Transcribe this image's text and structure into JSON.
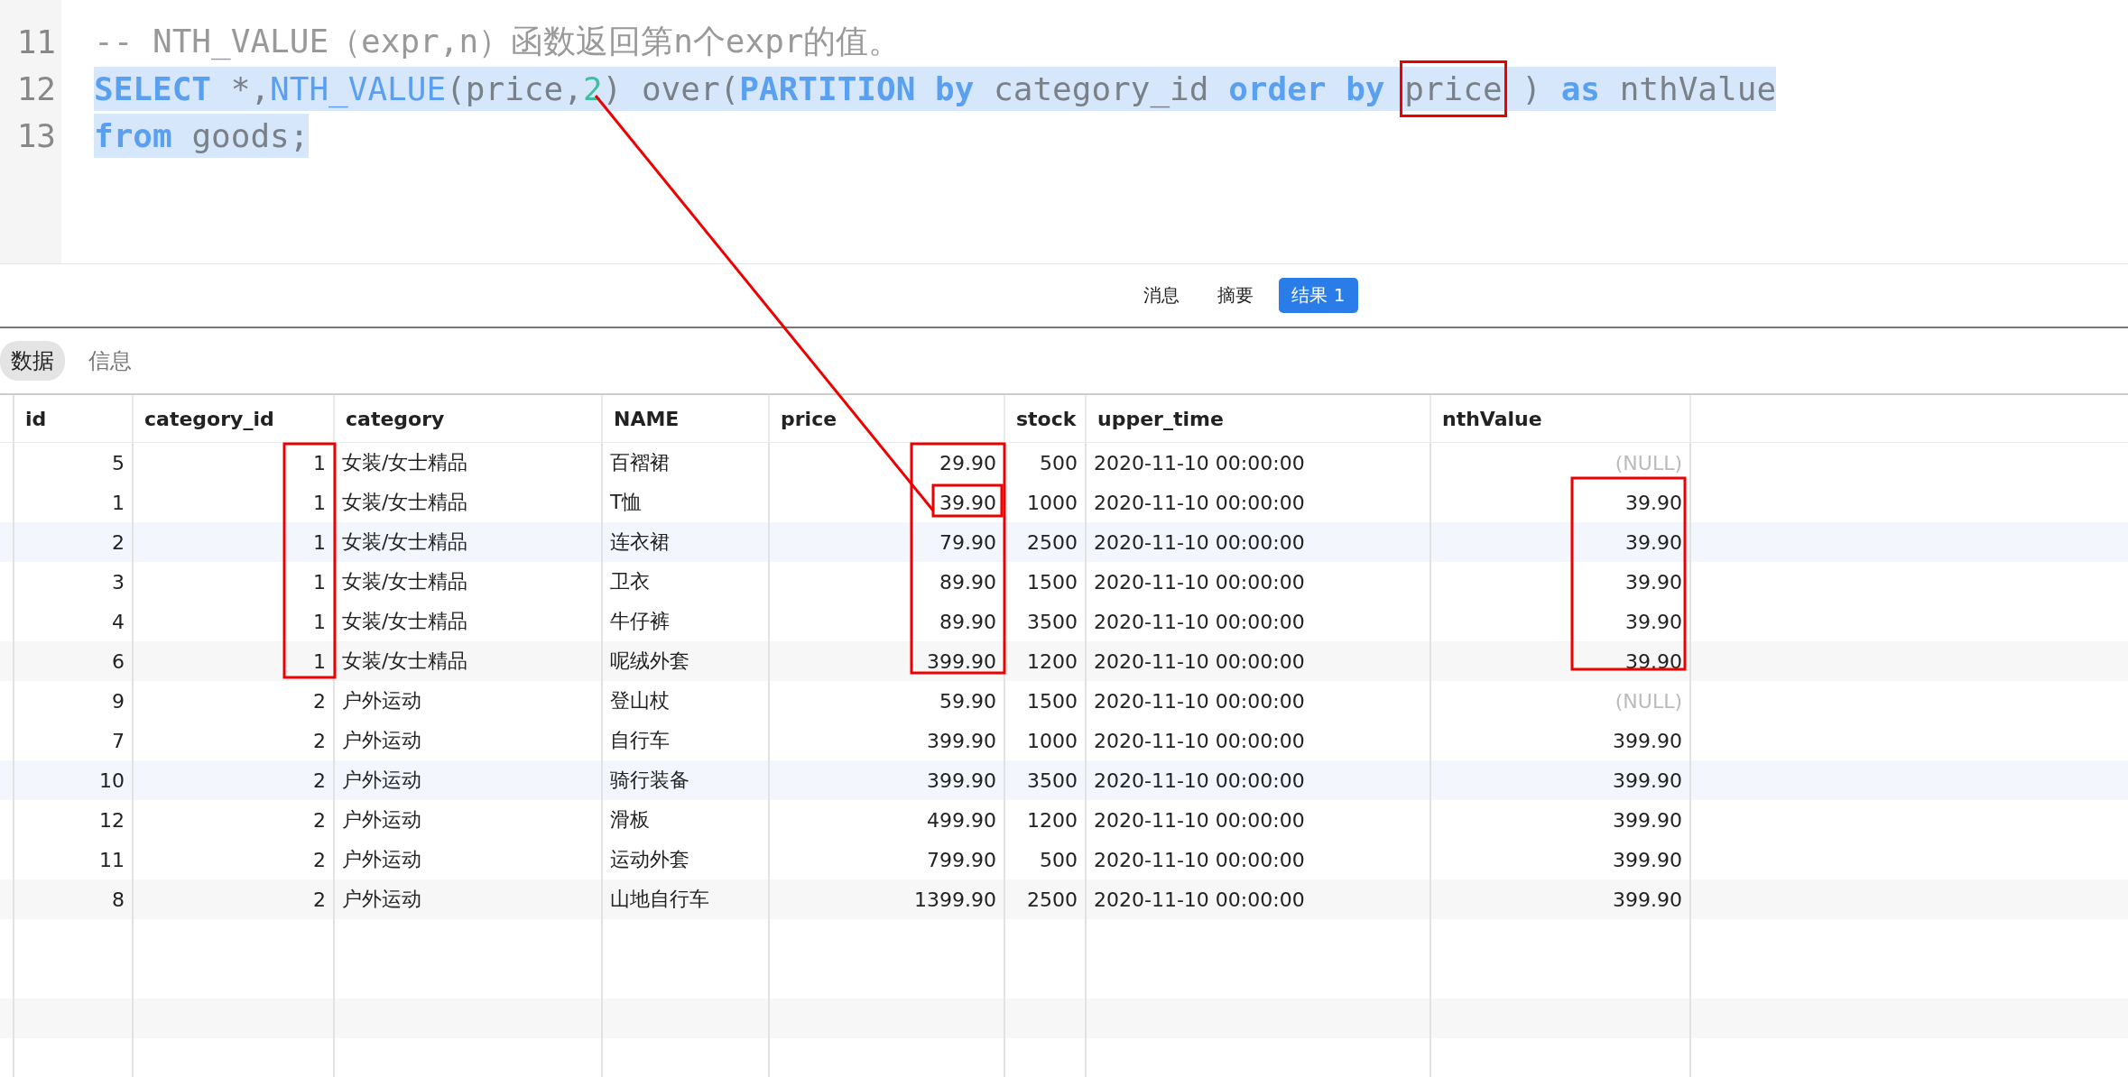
{
  "editor": {
    "lines": [
      {
        "number": "11",
        "selected": false,
        "tokens": [
          {
            "kind": "comment",
            "text": "-- NTH_VALUE（expr,n）函数返回第n个expr的值。"
          }
        ]
      },
      {
        "number": "12",
        "selected": true,
        "tokens": [
          {
            "kind": "keyword",
            "text": "SELECT"
          },
          {
            "kind": "plain",
            "text": " *,"
          },
          {
            "kind": "function",
            "text": "NTH_VALUE"
          },
          {
            "kind": "plain",
            "text": "(price,"
          },
          {
            "kind": "number",
            "text": "2"
          },
          {
            "kind": "plain",
            "text": ") over("
          },
          {
            "kind": "keyword",
            "text": "PARTITION by"
          },
          {
            "kind": "plain",
            "text": " category_id "
          },
          {
            "kind": "keyword",
            "text": "order by "
          },
          {
            "kind": "plain",
            "text": "price",
            "framed": true
          },
          {
            "kind": "plain",
            "text": " ) "
          },
          {
            "kind": "keyword",
            "text": "as"
          },
          {
            "kind": "plain",
            "text": " nthValue"
          }
        ]
      },
      {
        "number": "13",
        "selected": true,
        "tokens": [
          {
            "kind": "keyword",
            "text": "from"
          },
          {
            "kind": "plain",
            "text": " goods;"
          }
        ]
      }
    ]
  },
  "result_tabs": [
    {
      "label": "消息",
      "selected": false
    },
    {
      "label": "摘要",
      "selected": false
    },
    {
      "label": "结果 1",
      "selected": true
    }
  ],
  "view_tabs": [
    {
      "label": "数据",
      "selected": true
    },
    {
      "label": "信息",
      "selected": false
    }
  ],
  "table": {
    "columns": [
      "id",
      "category_id",
      "category",
      "NAME",
      "price",
      "stock",
      "upper_time",
      "nthValue"
    ],
    "rows": [
      {
        "cells": [
          "5",
          "1",
          "女装/女士精品",
          "百褶裙",
          "29.90",
          "500",
          "2020-11-10 00:00:00",
          "(NULL)"
        ],
        "null_value": true
      },
      {
        "cells": [
          "1",
          "1",
          "女装/女士精品",
          "T恤",
          "39.90",
          "1000",
          "2020-11-10 00:00:00",
          "39.90"
        ],
        "null_value": false
      },
      {
        "cells": [
          "2",
          "1",
          "女装/女士精品",
          "连衣裙",
          "79.90",
          "2500",
          "2020-11-10 00:00:00",
          "39.90"
        ],
        "null_value": false
      },
      {
        "cells": [
          "3",
          "1",
          "女装/女士精品",
          "卫衣",
          "89.90",
          "1500",
          "2020-11-10 00:00:00",
          "39.90"
        ],
        "null_value": false
      },
      {
        "cells": [
          "4",
          "1",
          "女装/女士精品",
          "牛仔裤",
          "89.90",
          "3500",
          "2020-11-10 00:00:00",
          "39.90"
        ],
        "null_value": false
      },
      {
        "cells": [
          "6",
          "1",
          "女装/女士精品",
          "呢绒外套",
          "399.90",
          "1200",
          "2020-11-10 00:00:00",
          "39.90"
        ],
        "null_value": false
      },
      {
        "cells": [
          "9",
          "2",
          "户外运动",
          "登山杖",
          "59.90",
          "1500",
          "2020-11-10 00:00:00",
          "(NULL)"
        ],
        "null_value": true
      },
      {
        "cells": [
          "7",
          "2",
          "户外运动",
          "自行车",
          "399.90",
          "1000",
          "2020-11-10 00:00:00",
          "399.90"
        ],
        "null_value": false
      },
      {
        "cells": [
          "10",
          "2",
          "户外运动",
          "骑行装备",
          "399.90",
          "3500",
          "2020-11-10 00:00:00",
          "399.90"
        ],
        "null_value": false
      },
      {
        "cells": [
          "12",
          "2",
          "户外运动",
          "滑板",
          "499.90",
          "1200",
          "2020-11-10 00:00:00",
          "399.90"
        ],
        "null_value": false
      },
      {
        "cells": [
          "11",
          "2",
          "户外运动",
          "运动外套",
          "799.90",
          "500",
          "2020-11-10 00:00:00",
          "399.90"
        ],
        "null_value": false
      },
      {
        "cells": [
          "8",
          "2",
          "户外运动",
          "山地自行车",
          "1399.90",
          "2500",
          "2020-11-10 00:00:00",
          "399.90"
        ],
        "null_value": false
      }
    ]
  }
}
